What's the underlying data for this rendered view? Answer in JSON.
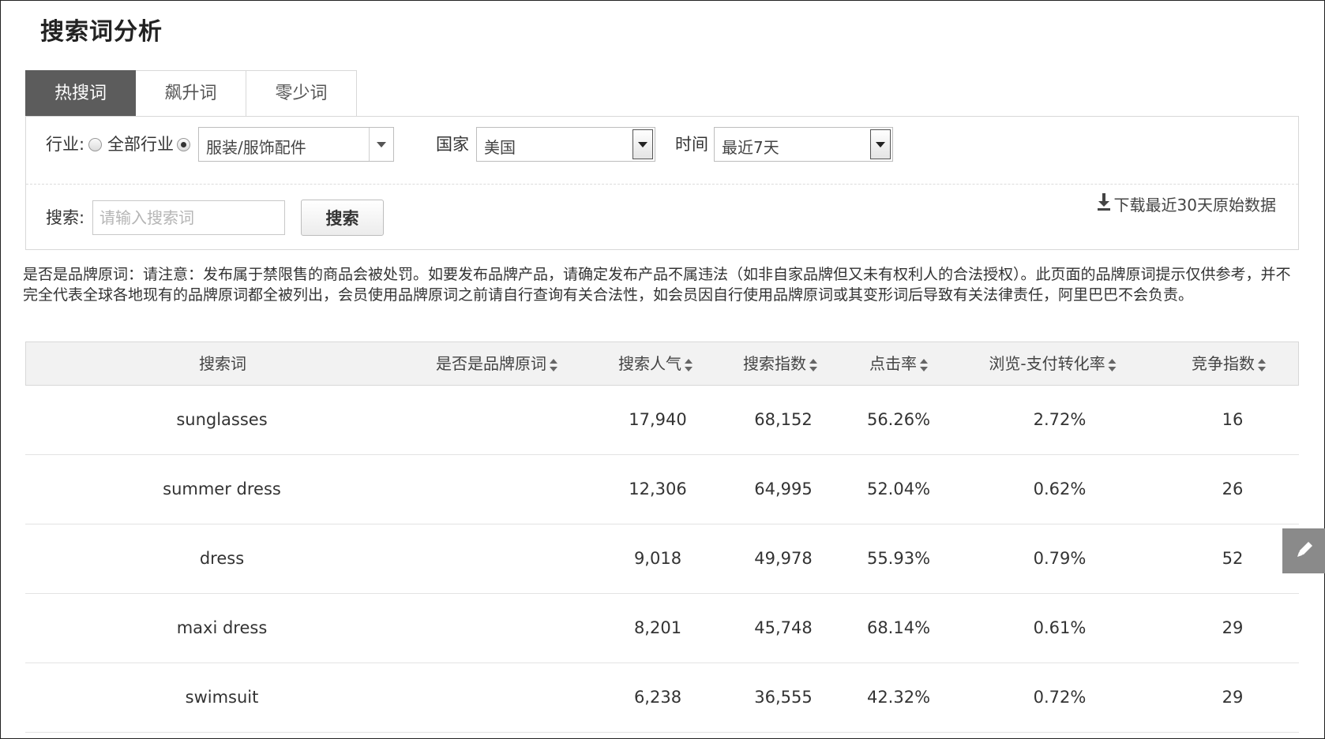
{
  "page": {
    "title": "搜索词分析"
  },
  "tabs": [
    {
      "label": "热搜词",
      "active": true
    },
    {
      "label": "飙升词",
      "active": false
    },
    {
      "label": "零少词",
      "active": false
    }
  ],
  "filters": {
    "industry_label": "行业:",
    "all_industry_label": "全部行业",
    "industry_selected": "服装/服饰配件",
    "country_label": "国家",
    "country_selected": "美国",
    "time_label": "时间",
    "time_selected": "最近7天",
    "search_label": "搜索:",
    "search_placeholder": "请输入搜索词",
    "search_button": "搜索",
    "download_label": "下载最近30天原始数据"
  },
  "notice": "是否是品牌原词：请注意：发布属于禁限售的商品会被处罚。如要发布品牌产品，请确定发布产品不属违法（如非自家品牌但又未有权利人的合法授权）。此页面的品牌原词提示仅供参考，并不完全代表全球各地现有的品牌原词都全被列出，会员使用品牌原词之前请自行查询有关合法性，如会员因自行使用品牌原词或其变形词后导致有关法律责任，阿里巴巴不会负责。",
  "table": {
    "headers": [
      "搜索词",
      "是否是品牌原词",
      "搜索人气",
      "搜索指数",
      "点击率",
      "浏览-支付转化率",
      "竞争指数"
    ],
    "rows": [
      [
        "sunglasses",
        "",
        "17,940",
        "68,152",
        "56.26%",
        "2.72%",
        "16"
      ],
      [
        "summer dress",
        "",
        "12,306",
        "64,995",
        "52.04%",
        "0.62%",
        "26"
      ],
      [
        "dress",
        "",
        "9,018",
        "49,978",
        "55.93%",
        "0.79%",
        "52"
      ],
      [
        "maxi dress",
        "",
        "8,201",
        "45,748",
        "68.14%",
        "0.61%",
        "29"
      ],
      [
        "swimsuit",
        "",
        "6,238",
        "36,555",
        "42.32%",
        "0.72%",
        "29"
      ]
    ]
  },
  "icons": {
    "download": "download-icon",
    "edit": "pencil-icon"
  }
}
